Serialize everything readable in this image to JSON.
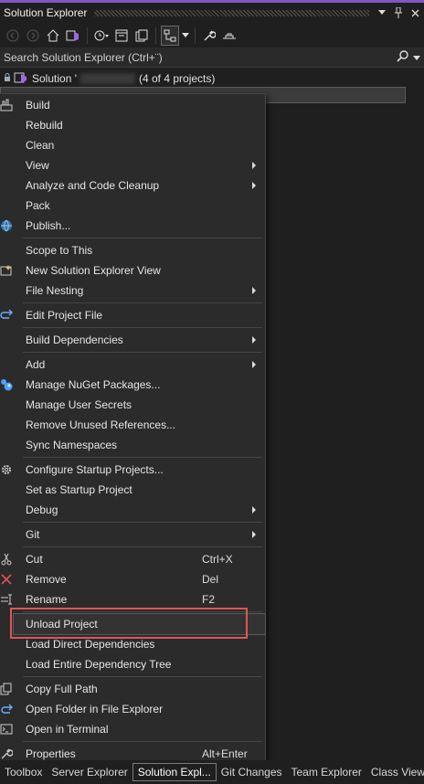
{
  "window": {
    "title": "Solution Explorer",
    "pin_icon": "pin-icon",
    "close_icon": "close-icon",
    "accent_color": "#7e57c2"
  },
  "toolbar": {
    "icons": [
      "back-icon",
      "forward-icon",
      "home-icon",
      "vs-switch-icon",
      "history-icon",
      "collapse-all-icon",
      "show-all-files-icon",
      "sync-active-document-icon",
      "properties-wrench-icon",
      "preview-icon"
    ]
  },
  "search": {
    "placeholder": "Search Solution Explorer (Ctrl+¨)"
  },
  "tree": {
    "solution_label": "Solution '",
    "solution_suffix": "(4 of 4 projects)"
  },
  "context_menu": {
    "items": [
      {
        "label": "Build",
        "icon": "build-icon"
      },
      {
        "label": "Rebuild"
      },
      {
        "label": "Clean"
      },
      {
        "label": "View",
        "submenu": true
      },
      {
        "label": "Analyze and Code Cleanup",
        "submenu": true
      },
      {
        "label": "Pack"
      },
      {
        "label": "Publish...",
        "icon": "globe-icon"
      },
      {
        "label": "Scope to This"
      },
      {
        "label": "New Solution Explorer View",
        "icon": "new-view-icon"
      },
      {
        "label": "File Nesting",
        "submenu": true
      },
      {
        "label": "Edit Project File",
        "icon": "edit-arrow-icon"
      },
      {
        "label": "Build Dependencies",
        "submenu": true
      },
      {
        "label": "Add",
        "submenu": true
      },
      {
        "label": "Manage NuGet Packages...",
        "icon": "nuget-icon"
      },
      {
        "label": "Manage User Secrets"
      },
      {
        "label": "Remove Unused References..."
      },
      {
        "label": "Sync Namespaces"
      },
      {
        "label": "Configure Startup Projects...",
        "icon": "gear-icon"
      },
      {
        "label": "Set as Startup Project"
      },
      {
        "label": "Debug",
        "submenu": true
      },
      {
        "label": "Git",
        "submenu": true
      },
      {
        "label": "Cut",
        "shortcut": "Ctrl+X",
        "icon": "scissors-icon"
      },
      {
        "label": "Remove",
        "shortcut": "Del",
        "icon": "remove-x-icon"
      },
      {
        "label": "Rename",
        "shortcut": "F2",
        "icon": "rename-icon"
      },
      {
        "label": "Unload Project"
      },
      {
        "label": "Load Direct Dependencies"
      },
      {
        "label": "Load Entire Dependency Tree"
      },
      {
        "label": "Copy Full Path",
        "icon": "copy-icon"
      },
      {
        "label": "Open Folder in File Explorer",
        "icon": "folder-arrow-icon"
      },
      {
        "label": "Open in Terminal",
        "icon": "terminal-icon"
      },
      {
        "label": "Properties",
        "shortcut": "Alt+Enter",
        "icon": "wrench-icon"
      }
    ],
    "highlight_color": "#e05555"
  },
  "bottom_tabs": {
    "toolbox": "Toolbox",
    "server_explorer": "Server Explorer",
    "solution_explorer": "Solution Expl...",
    "git_changes": "Git Changes",
    "team_explorer": "Team Explorer",
    "class_view": "Class View"
  }
}
